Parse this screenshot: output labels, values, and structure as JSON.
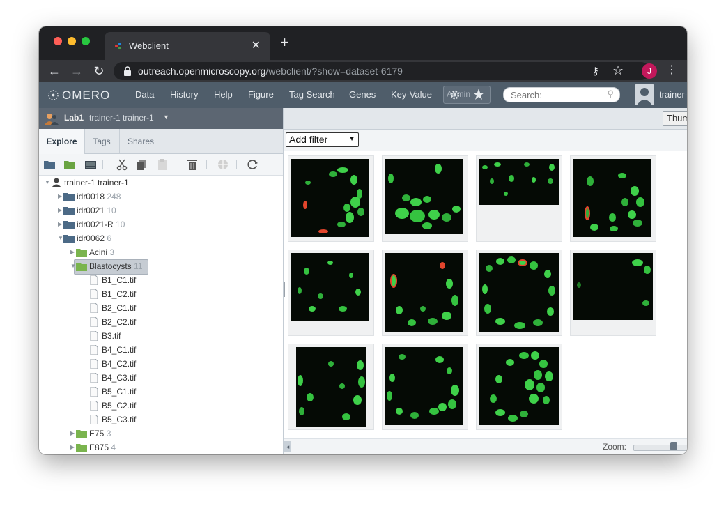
{
  "browser": {
    "tab_title": "Webclient",
    "tab_close": "✕",
    "new_tab": "+",
    "url_host": "outreach.openmicroscopy.org",
    "url_path": "/webclient/?show=dataset-6179",
    "profile_initial": "J"
  },
  "omero": {
    "logo": "OMERO",
    "nav": [
      "Data",
      "History",
      "Help",
      "Figure",
      "Tag Search",
      "Genes",
      "Key-Value"
    ],
    "admin": "Admin",
    "search_placeholder": "Search:",
    "user": "trainer-"
  },
  "left": {
    "group_name": "Lab1",
    "group_user": "trainer-1 trainer-1",
    "tabs": [
      "Explore",
      "Tags",
      "Shares"
    ],
    "tree": {
      "root": "trainer-1 trainer-1",
      "items": [
        {
          "name": "idr0018",
          "count": "248"
        },
        {
          "name": "idr0021",
          "count": "10"
        },
        {
          "name": "idr0021-R",
          "count": "10"
        },
        {
          "name": "idr0062",
          "count": "6"
        },
        {
          "name": "Acini",
          "count": "3"
        },
        {
          "name": "Blastocysts",
          "count": "11"
        },
        {
          "name": "E75",
          "count": "3"
        },
        {
          "name": "E875",
          "count": "4"
        }
      ],
      "files": [
        "B1_C1.tif",
        "B1_C2.tif",
        "B2_C1.tif",
        "B2_C2.tif",
        "B3.tif",
        "B4_C1.tif",
        "B4_C2.tif",
        "B4_C3.tif",
        "B5_C1.tif",
        "B5_C2.tif",
        "B5_C3.tif"
      ]
    }
  },
  "center": {
    "thumb_button": "Thum",
    "filter_label": "Add filter",
    "zoom_label": "Zoom:",
    "zoom_level": 0.65
  },
  "colors": {
    "header": "#4f5d6a",
    "cell_green": "#3fd14a",
    "cell_red": "#e2452c"
  }
}
